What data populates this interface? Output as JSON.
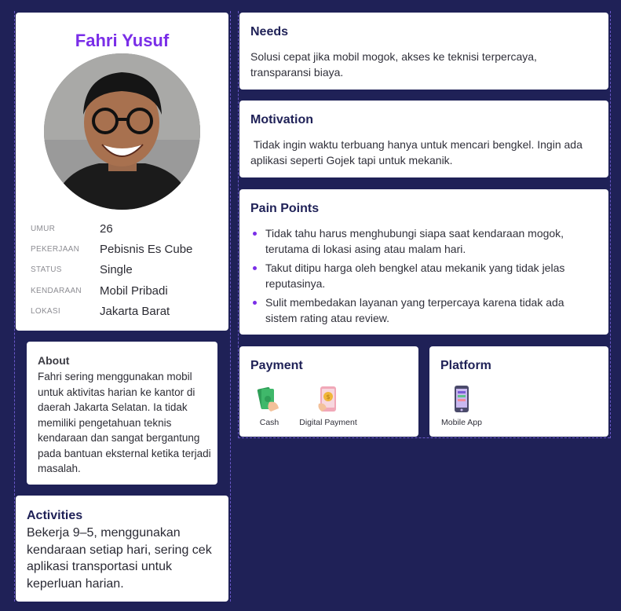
{
  "profile": {
    "name": "Fahri Yusuf",
    "fields": [
      {
        "label": "UMUR",
        "value": "26"
      },
      {
        "label": "PEKERJAAN",
        "value": "Pebisnis Es Cube"
      },
      {
        "label": "STATUS",
        "value": "Single"
      },
      {
        "label": "KENDARAAN",
        "value": "Mobil Pribadi"
      },
      {
        "label": "LOKASI",
        "value": "Jakarta Barat"
      }
    ]
  },
  "about": {
    "title": "About",
    "text": "Fahri sering menggunakan mobil untuk aktivitas harian ke kantor di daerah Jakarta Selatan. Ia tidak memiliki pengetahuan teknis kendaraan dan sangat bergantung pada bantuan eksternal ketika terjadi masalah."
  },
  "activities": {
    "title": "Activities",
    "text": "Bekerja 9–5, menggunakan kendaraan setiap hari, sering cek aplikasi transportasi untuk keperluan harian."
  },
  "needs": {
    "title": "Needs",
    "text": "Solusi cepat jika mobil mogok, akses ke teknisi terpercaya, transparansi biaya."
  },
  "motivation": {
    "title": "Motivation",
    "text": " Tidak ingin waktu terbuang hanya untuk mencari bengkel. Ingin ada aplikasi seperti Gojek tapi untuk mekanik."
  },
  "pain_points": {
    "title": "Pain Points",
    "items": [
      "Tidak tahu harus menghubungi siapa saat kendaraan mogok, terutama di lokasi asing atau malam hari.",
      "Takut ditipu harga oleh bengkel atau mekanik yang tidak jelas reputasinya.",
      "Sulit membedakan layanan yang terpercaya karena tidak ada sistem rating atau review."
    ]
  },
  "payment": {
    "title": "Payment",
    "options": [
      {
        "label": "Cash",
        "icon": "cash-icon"
      },
      {
        "label": "Digital Payment",
        "icon": "digital-payment-icon"
      }
    ]
  },
  "platform": {
    "title": "Platform",
    "options": [
      {
        "label": "Mobile App",
        "icon": "mobile-phone-icon"
      }
    ]
  },
  "colors": {
    "background": "#1f2157",
    "accent": "#7a2ee8",
    "card": "#ffffff",
    "heading": "#1f2157"
  }
}
